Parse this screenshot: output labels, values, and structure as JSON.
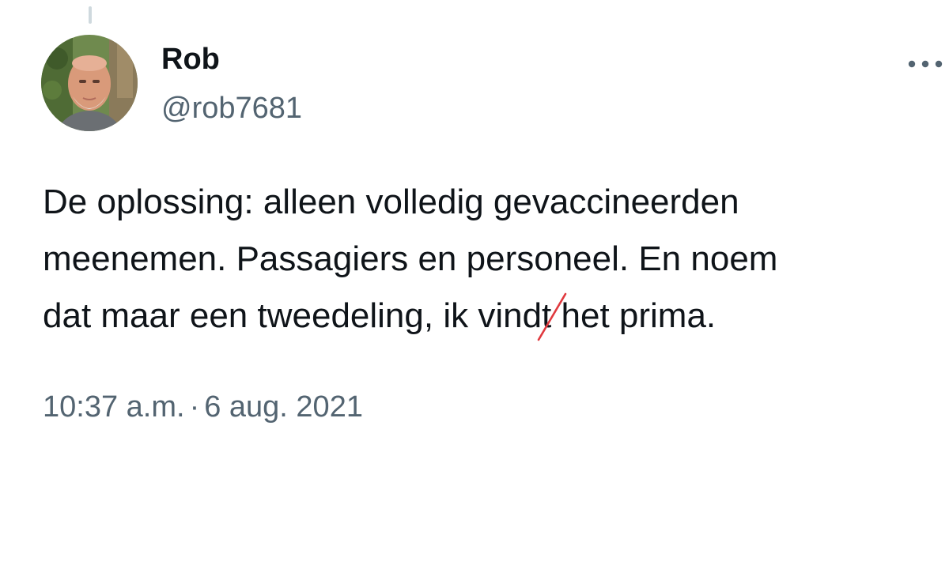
{
  "tweet": {
    "author": {
      "display_name": "Rob",
      "handle": "@rob7681"
    },
    "text_lines": [
      "De oplossing: alleen volledig gevaccineerden",
      "meenemen. Passagiers en personeel. En noem"
    ],
    "last_line": {
      "before": "dat maar een tweedeling, ik vind",
      "struck": "t",
      "after": " het prima."
    },
    "correction_color": "#e0393e",
    "time": "10:37 a.m.",
    "separator": "·",
    "date": "6 aug. 2021",
    "more_icon": "more-horizontal-icon",
    "avatar_icon": "user-avatar-photo"
  }
}
